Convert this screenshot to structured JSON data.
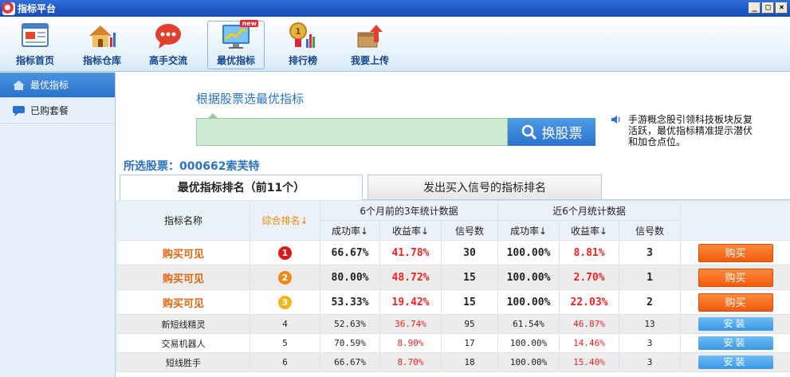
{
  "window": {
    "title": "指标平台",
    "controls": [
      "_",
      "□",
      "×"
    ]
  },
  "toolbar": {
    "items": [
      {
        "label": "指标首页",
        "icon": "web-page-icon"
      },
      {
        "label": "指标仓库",
        "icon": "house-chart-icon"
      },
      {
        "label": "高手交流",
        "icon": "chat-bubble-icon"
      },
      {
        "label": "最优指标",
        "icon": "trend-monitor-icon",
        "badge": "new",
        "active": true
      },
      {
        "label": "排行榜",
        "icon": "medal-chart-icon"
      },
      {
        "label": "我要上传",
        "icon": "upload-box-icon"
      }
    ]
  },
  "sidebar": {
    "items": [
      {
        "label": "最优指标",
        "icon": "home-icon",
        "active": true
      },
      {
        "label": "已购套餐",
        "icon": "message-icon",
        "active": false
      }
    ]
  },
  "search": {
    "title": "根据股票选最优指标",
    "value": "",
    "button_label": "换股票"
  },
  "notice": {
    "text": "手游概念股引领科技板块反复活跃，最优指标精准提示潜伏和加仓点位。"
  },
  "selected_stock": "所选股票：000662索芙特",
  "tabs": [
    {
      "label": "最优指标排名（前11个）",
      "active": true
    },
    {
      "label": "发出买入信号的指标排名",
      "active": false
    }
  ],
  "table": {
    "headers": {
      "name": "指标名称",
      "rank": "综合排名↓",
      "group1": "6个月前的3年统计数据",
      "group2": "近6个月统计数据",
      "success": "成功率↓",
      "return": "收益率↓",
      "signals": "信号数"
    },
    "rows": [
      {
        "name": "购买可见",
        "rank": "1",
        "rank_color": "#d91a1a",
        "s1": "66.67%",
        "r1": "41.78%",
        "n1": "30",
        "s2": "100.00%",
        "r2": "8.81%",
        "n2": "3",
        "action": "购买"
      },
      {
        "name": "购买可见",
        "rank": "2",
        "rank_color": "#f0891a",
        "s1": "80.00%",
        "r1": "48.72%",
        "n1": "15",
        "s2": "100.00%",
        "r2": "2.70%",
        "n2": "1",
        "action": "购买"
      },
      {
        "name": "购买可见",
        "rank": "3",
        "rank_color": "#f2b61c",
        "s1": "53.33%",
        "r1": "19.42%",
        "n1": "15",
        "s2": "100.00%",
        "r2": "22.03%",
        "n2": "2",
        "action": "购买"
      },
      {
        "name": "新短线精灵",
        "rank": "4",
        "s1": "52.63%",
        "r1": "36.74%",
        "n1": "95",
        "s2": "61.54%",
        "r2": "46.87%",
        "n2": "13",
        "action": "安装"
      },
      {
        "name": "交易机器人",
        "rank": "5",
        "s1": "70.59%",
        "r1": "8.90%",
        "n1": "17",
        "s2": "100.00%",
        "r2": "14.46%",
        "n2": "3",
        "action": "安装"
      },
      {
        "name": "短线胜手",
        "rank": "6",
        "s1": "66.67%",
        "r1": "8.70%",
        "n1": "18",
        "s2": "100.00%",
        "r2": "15.40%",
        "n2": "3",
        "action": "安装"
      }
    ]
  }
}
